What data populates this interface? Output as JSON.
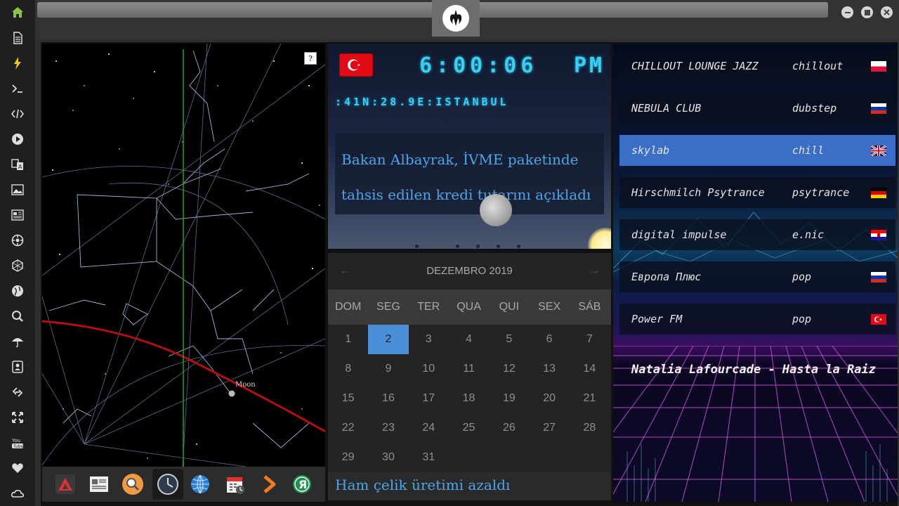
{
  "sidebar": {
    "items": [
      {
        "icon": "home-icon"
      },
      {
        "icon": "document-icon"
      },
      {
        "icon": "lightning-icon"
      },
      {
        "icon": "terminal-icon"
      },
      {
        "icon": "code-icon"
      },
      {
        "icon": "play-icon"
      },
      {
        "icon": "translate-icon"
      },
      {
        "icon": "image-icon"
      },
      {
        "icon": "news-icon"
      },
      {
        "icon": "settings-gear-icon"
      },
      {
        "icon": "hexagon-icon"
      },
      {
        "icon": "globe-icon"
      },
      {
        "icon": "search-icon"
      },
      {
        "icon": "umbrella-icon"
      },
      {
        "icon": "contacts-icon"
      },
      {
        "icon": "link-icon"
      },
      {
        "icon": "expand-icon"
      },
      {
        "icon": "youtube-icon"
      },
      {
        "icon": "heart-icon"
      },
      {
        "icon": "cloud-icon"
      }
    ],
    "accent": "#8bc34a"
  },
  "skymap": {
    "moon_label": "Moon",
    "help_label": "?"
  },
  "clock": {
    "time": "6:00:06",
    "ampm": "PM",
    "coords": ":41N:28.9E:ISTANBUL",
    "headline": "Bakan Albayrak, İVME paketinde tahsis edilen kredi tutarını açıkladı"
  },
  "calendar": {
    "month": "DEZEMBRO 2019",
    "prev_label": "←",
    "next_label": "→",
    "dows": [
      "DOM",
      "SEG",
      "TER",
      "QUA",
      "QUI",
      "SEX",
      "SÁB"
    ],
    "weeks": [
      [
        "1",
        "2",
        "3",
        "4",
        "5",
        "6",
        "7"
      ],
      [
        "8",
        "9",
        "10",
        "11",
        "12",
        "13",
        "14"
      ],
      [
        "15",
        "16",
        "17",
        "18",
        "19",
        "20",
        "21"
      ],
      [
        "22",
        "23",
        "24",
        "25",
        "26",
        "27",
        "28"
      ],
      [
        "29",
        "30",
        "31",
        "",
        "",
        "",
        ""
      ]
    ],
    "selected": "2",
    "selected_color": "#4a90d9"
  },
  "ticker": {
    "text": "Ham çelik üretimi azaldı"
  },
  "radio": {
    "stations": [
      {
        "name": "CHILLOUT LOUNGE JAZZ",
        "genre": "chillout",
        "flag": "poland-flag"
      },
      {
        "name": "NEBULA CLUB",
        "genre": "dubstep",
        "flag": "russia-flag"
      },
      {
        "name": "skylab",
        "genre": "chill",
        "flag": "uk-flag",
        "active": true
      },
      {
        "name": "Hirschmilch Psytrance",
        "genre": "psytrance",
        "flag": "germany-flag"
      },
      {
        "name": "digital impulse",
        "genre": "e.nic",
        "flag": "croatia-flag"
      },
      {
        "name": "Европа Плюс",
        "genre": "pop",
        "flag": "russia-flag"
      },
      {
        "name": "Power FM",
        "genre": "pop",
        "flag": "turkey-flag"
      }
    ],
    "now_playing": "Natalia Lafourcade - Hasta la Raiz",
    "active_color": "#3b6ec6"
  },
  "dock": {
    "items": [
      {
        "icon": "app-launcher-icon"
      },
      {
        "icon": "newspaper-icon"
      },
      {
        "icon": "magnifier-icon"
      },
      {
        "icon": "clock-icon",
        "active": true
      },
      {
        "icon": "globe-icon"
      },
      {
        "icon": "calendar-icon"
      },
      {
        "icon": "arrow-icon"
      },
      {
        "icon": "yandex-icon"
      }
    ]
  }
}
